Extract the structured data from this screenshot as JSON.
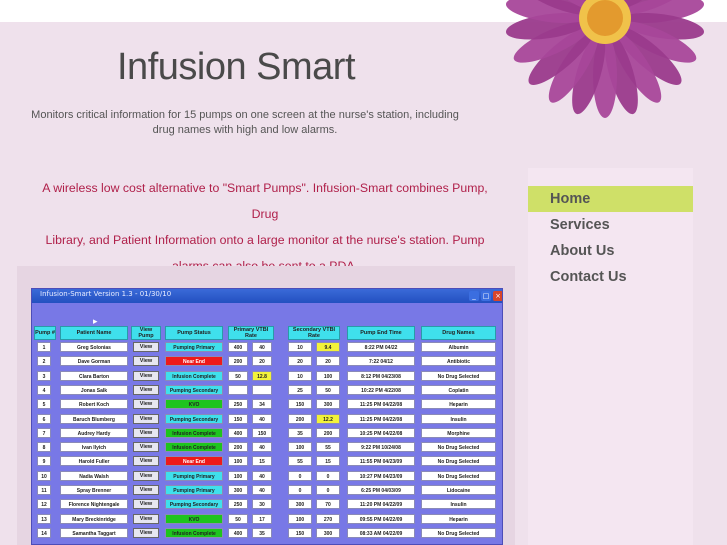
{
  "site": {
    "title": "Infusion Smart",
    "tagline_line1": "Monitors critical information for 15 pumps on one screen at the nurse's station, including",
    "tagline_line2": "drug names with high and low alarms.",
    "intro_line1": "A wireless low cost alternative to \"Smart Pumps\". Infusion-Smart combines Pump, Drug",
    "intro_line2": "Library, and Patient Information onto a large monitor at the nurse's station.  Pump",
    "intro_line3": "alarms can also be sent to a PDA."
  },
  "nav": {
    "items": [
      {
        "label": "Home",
        "active": true
      },
      {
        "label": "Services",
        "active": false
      },
      {
        "label": "About Us",
        "active": false
      },
      {
        "label": "Contact Us",
        "active": false
      }
    ]
  },
  "colors": {
    "active_nav": "#cfe068",
    "intro_text": "#b0204a",
    "flower": "#a8479a"
  },
  "app": {
    "window_title": "Infusion-Smart Version 1.3 - 01/30/10",
    "headers": {
      "pump": "Pump #",
      "patient": "Patient Name",
      "view": "View Pump",
      "status": "Pump Status",
      "primary": "Primary VTBI  Rate",
      "secondary": "Secondary VTBI  Rate",
      "end_time": "Pump End Time",
      "drug": "Drug Names"
    },
    "view_label": "View",
    "rows": [
      {
        "n": "1",
        "patient": "Greg Solonias",
        "status": "Pumping Primary",
        "status_color": "#3fe0ec",
        "p_vtbi": "400",
        "p_rate": "40",
        "s_vtbi": "10",
        "s_rate": "9.4",
        "s_rate_hl": true,
        "end": "8:22 PM 04/22",
        "drug": "Albumin"
      },
      {
        "n": "2",
        "patient": "Dave Gorman",
        "status": "Near End",
        "status_color": "#ee1a1a",
        "p_vtbi": "200",
        "p_rate": "20",
        "s_vtbi": "20",
        "s_rate": "20",
        "s_rate_hl": false,
        "end": "7:22 04/12",
        "drug": "Antibiotic"
      },
      {
        "n": "3",
        "patient": "Clara Barton",
        "status": "Infusion Complete",
        "status_color": "#3fe0ec",
        "p_vtbi": "50",
        "p_rate": "12.8",
        "p_rate_hl": true,
        "s_vtbi": "10",
        "s_rate": "100",
        "s_rate_hl": false,
        "end": "8:12 PM 04/23/08",
        "drug": "No Drug Selected"
      },
      {
        "n": "4",
        "patient": "Jonas Salk",
        "status": "Pumping Secondary",
        "status_color": "#3fe0ec",
        "p_vtbi": "",
        "p_rate": "",
        "s_vtbi": "25",
        "s_rate": "50",
        "s_rate_hl": false,
        "end": "10:22 PM 4/22/08",
        "drug": "Coplatin"
      },
      {
        "n": "5",
        "patient": "Robert Koch",
        "status": "KVO",
        "status_color": "#1ec41e",
        "p_vtbi": "250",
        "p_rate": "34",
        "s_vtbi": "150",
        "s_rate": "300",
        "s_rate_hl": false,
        "end": "11:25 PM 04/22/08",
        "drug": "Heparin"
      },
      {
        "n": "6",
        "patient": "Baruch Blumberg",
        "status": "Pumping Secondary",
        "status_color": "#3fe0ec",
        "p_vtbi": "150",
        "p_rate": "40",
        "s_vtbi": "200",
        "s_rate": "12.2",
        "s_rate_hl": true,
        "end": "11:25 PM 04/22/08",
        "drug": "Insulin"
      },
      {
        "n": "7",
        "patient": "Audrey Hardy",
        "status": "Infusion Complete",
        "status_color": "#1ec41e",
        "p_vtbi": "400",
        "p_rate": "150",
        "s_vtbi": "35",
        "s_rate": "200",
        "s_rate_hl": false,
        "end": "10:25 PM 04/22/08",
        "drug": "Morphine"
      },
      {
        "n": "8",
        "patient": "Ivan Ilyich",
        "status": "Infusion Complete",
        "status_color": "#1ec41e",
        "p_vtbi": "200",
        "p_rate": "40",
        "s_vtbi": "100",
        "s_rate": "55",
        "s_rate_hl": false,
        "end": "9:22 PM 10/24/08",
        "drug": "No Drug Selected"
      },
      {
        "n": "9",
        "patient": "Harold Fuller",
        "status": "Near End",
        "status_color": "#ee1a1a",
        "p_vtbi": "100",
        "p_rate": "15",
        "s_vtbi": "55",
        "s_rate": "15",
        "s_rate_hl": false,
        "end": "11:55 PM 04/23/09",
        "drug": "No Drug Selected"
      },
      {
        "n": "10",
        "patient": "Nadia Walsh",
        "status": "Pumping Primary",
        "status_color": "#3fe0ec",
        "p_vtbi": "100",
        "p_rate": "40",
        "s_vtbi": "0",
        "s_rate": "0",
        "s_rate_hl": false,
        "end": "10:27 PM 04/23/09",
        "drug": "No Drug Selected"
      },
      {
        "n": "11",
        "patient": "Spray Brenner",
        "status": "Pumping Primary",
        "status_color": "#3fe0ec",
        "p_vtbi": "300",
        "p_rate": "40",
        "s_vtbi": "0",
        "s_rate": "0",
        "s_rate_hl": false,
        "end": "6:25 PM 04/03/09",
        "drug": "Lidocaine"
      },
      {
        "n": "12",
        "patient": "Florence Nightengale",
        "status": "Pumping Secondary",
        "status_color": "#3fe0ec",
        "p_vtbi": "250",
        "p_rate": "30",
        "s_vtbi": "300",
        "s_rate": "70",
        "s_rate_hl": false,
        "end": "11:20 PM 04/22/09",
        "drug": "Insulin"
      },
      {
        "n": "13",
        "patient": "Mary Breckinridge",
        "status": "KVO",
        "status_color": "#1ec41e",
        "p_vtbi": "50",
        "p_rate": "17",
        "s_vtbi": "100",
        "s_rate": "270",
        "s_rate_hl": false,
        "end": "09:55 PM 04/22/09",
        "drug": "Heparin"
      },
      {
        "n": "14",
        "patient": "Samantha Taggart",
        "status": "Infusion Complete",
        "status_color": "#1ec41e",
        "p_vtbi": "400",
        "p_rate": "35",
        "s_vtbi": "150",
        "s_rate": "300",
        "s_rate_hl": false,
        "end": "08:33 AM 04/22/09",
        "drug": "No Drug Selected"
      }
    ]
  }
}
